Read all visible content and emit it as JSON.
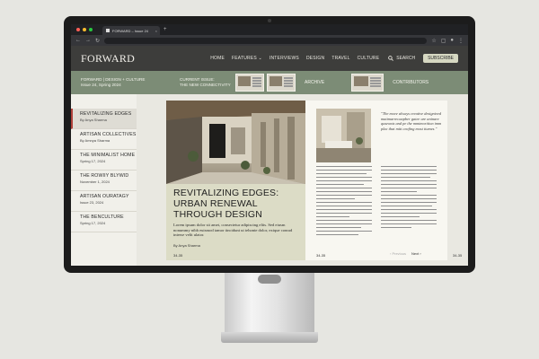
{
  "browser": {
    "tab_title": "FORWARD – Issue 24",
    "new_tab": "+",
    "close_tab": "×",
    "back": "←",
    "forward": "→",
    "reload": "↻"
  },
  "site": {
    "logo": "FORWARD",
    "nav": [
      "HOME",
      "FEATURES ⌄",
      "INTERVIEWS",
      "DESIGN",
      "TRAVEL",
      "CULTURE"
    ],
    "search_label": "SEARCH",
    "subscribe_label": "SUBSCRIBE"
  },
  "banner": {
    "tagline_1": "FORWARD | DESIGN + CULTURE",
    "tagline_2": "Issue 24, Spring 2024",
    "current_label_1": "CURRENT ISSUE:",
    "current_label_2": "THE NEW CONNECTIVITY",
    "archive_label": "ARCHIVE",
    "contributors_label": "CONTRIBUTORS"
  },
  "sidebar": {
    "items": [
      {
        "title": "REVITALIZING EDGES",
        "sub": "By Anya Sharma"
      },
      {
        "title": "ARTISAN COLLECTIVES",
        "sub": "By Amnya Sharma"
      },
      {
        "title": "THE MINIMALIST HOME",
        "sub": "Spring 17, 2024"
      },
      {
        "title": "THE ROWIIY BLYWID",
        "sub": "November 1, 2024"
      },
      {
        "title": "ARTISAN OURATAGY",
        "sub": "Issue 23, 2024"
      },
      {
        "title": "THE BENCULTURE",
        "sub": "Spring 17, 2024"
      }
    ]
  },
  "article": {
    "title_1": "REVITALIZING EDGES:",
    "title_2": "URBAN RENEWAL",
    "title_3": "THROUGH DESIGN",
    "lede": "Lorem ipsum dolor sit amet, consectetur adipiscing elits. Sed eiusm nonummy nibh euismod tamor tincidunt ut tehonte dolor, exique conrad interse velit ulator.",
    "byline": "By Anya Sharma",
    "folio_left": "34-35",
    "quote": "\"The move always creative designived mattmarrecaapber gatee ure aninare quseonts and pe the mmtmorition imm plac that mitt ceafing most tiumes.\"",
    "folio_right_left": "34-35",
    "folio_right": "34-35",
    "prev": "Previous",
    "next": "Next"
  }
}
